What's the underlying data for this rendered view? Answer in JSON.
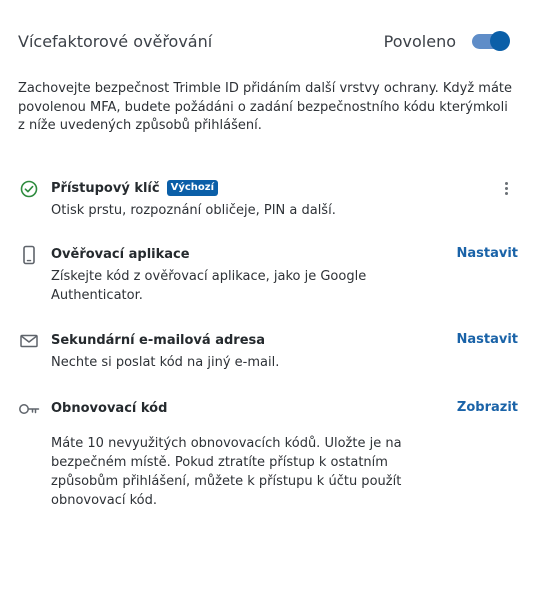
{
  "header": {
    "title": "Vícefaktorové ověřování",
    "toggle_label": "Povoleno",
    "toggle_on": true
  },
  "description": "Zachovejte bezpečnost Trimble ID přidáním další vrstvy ochrany. Když máte povolenou MFA, budete požádáni o zadání bezpečnostního kódu kterýmkoli z níže uvedených způsobů přihlášení.",
  "methods": [
    {
      "icon": "check-circle-icon",
      "name": "Přístupový klíč",
      "badge": "Výchozí",
      "description": "Otisk prstu, rozpoznání obličeje, PIN a další."
    },
    {
      "icon": "smartphone-icon",
      "name": "Ověřovací aplikace",
      "description": "Získejte kód z ověřovací aplikace, jako je Google Authenticator.",
      "action": "Nastavit"
    },
    {
      "icon": "envelope-icon",
      "name": "Sekundární e-mailová adresa",
      "description": "Nechte si poslat kód na jiný e-mail.",
      "action": "Nastavit"
    },
    {
      "icon": "key-icon",
      "name": "Obnovovací kód",
      "description": "Máte 10 nevyužitých obnovovacích kódů. Uložte je na bezpečném místě. Pokud ztratíte přístup k ostatním způsobům přihlášení, můžete k přístupu k účtu použít obnovovací kód.",
      "action": "Zobrazit"
    }
  ],
  "colors": {
    "accent": "#0b5fa8",
    "link": "#1a63a8",
    "success": "#2e8b3e",
    "toggle_track": "#5f8dc8"
  }
}
